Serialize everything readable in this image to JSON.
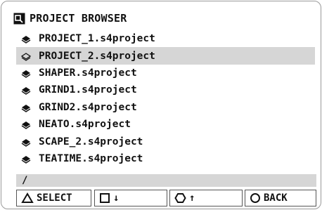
{
  "header": {
    "title": "PROJECT BROWSER",
    "icon": "folder-icon"
  },
  "projects": [
    {
      "label": "PROJECT_1.s4project",
      "selected": false
    },
    {
      "label": "PROJECT_2.s4project",
      "selected": true
    },
    {
      "label": "SHAPER.s4project",
      "selected": false
    },
    {
      "label": "GRIND1.s4project",
      "selected": false
    },
    {
      "label": "GRIND2.s4project",
      "selected": false
    },
    {
      "label": "NEATO.s4project",
      "selected": false
    },
    {
      "label": "SCAPE_2.s4project",
      "selected": false
    },
    {
      "label": "TEATIME.s4project",
      "selected": false
    }
  ],
  "path": "/",
  "buttons": [
    {
      "icon": "triangle-icon",
      "label": "SELECT"
    },
    {
      "icon": "square-icon",
      "label": "↓"
    },
    {
      "icon": "hexagon-icon",
      "label": "↑"
    },
    {
      "icon": "circle-icon",
      "label": "BACK"
    }
  ],
  "colors": {
    "highlight": "#d6d6d6",
    "text": "#111111",
    "border": "#9a9a9a"
  }
}
